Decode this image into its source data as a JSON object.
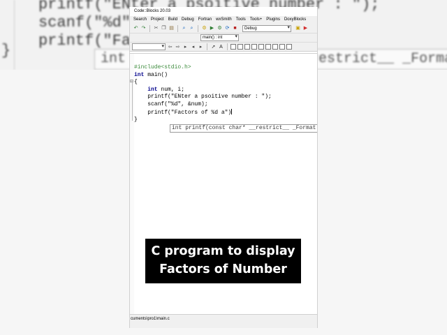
{
  "background": {
    "code_lines": [
      "printf(\"ENter a psoitive number : \");",
      "scanf(\"%d\", &num);",
      "printf(\"Fa"
    ],
    "brace": "}",
    "calltip": "int printf(const char* __restrict__ _Format"
  },
  "app": {
    "title": "Code::Blocks 20.03",
    "menu": [
      "Search",
      "Project",
      "Build",
      "Debug",
      "Fortran",
      "wxSmith",
      "Tools",
      "Tools+",
      "Plugins",
      "DoxyBlocks"
    ],
    "build_target": "Debug",
    "function_scope": "main() : int"
  },
  "editor": {
    "lines": [
      {
        "type": "pp",
        "text": "#include<stdio.h>"
      },
      {
        "type": "sig",
        "kw": "int",
        "rest": " main()"
      },
      {
        "type": "plain",
        "text": "{"
      },
      {
        "type": "decl",
        "kw": "int",
        "rest": " num, i;"
      },
      {
        "type": "plain",
        "text": "    printf(\"ENter a psoitive number : \");"
      },
      {
        "type": "plain",
        "text": "    scanf(\"%d\", &num);"
      },
      {
        "type": "plain",
        "text": "    printf(\"Factors of %d a\")"
      },
      {
        "type": "plain",
        "text": "}"
      }
    ],
    "calltip": "int printf(const char* __restrict__ _Format"
  },
  "status": {
    "path": "cuments\\pro1\\main.c"
  },
  "caption": {
    "line1": "C program to display",
    "line2": "Factors of Number"
  },
  "colors": {
    "caption_bg": "#000000",
    "caption_fg": "#ffffff",
    "preprocessor": "#3a8a3a",
    "keyword": "#00008b"
  }
}
